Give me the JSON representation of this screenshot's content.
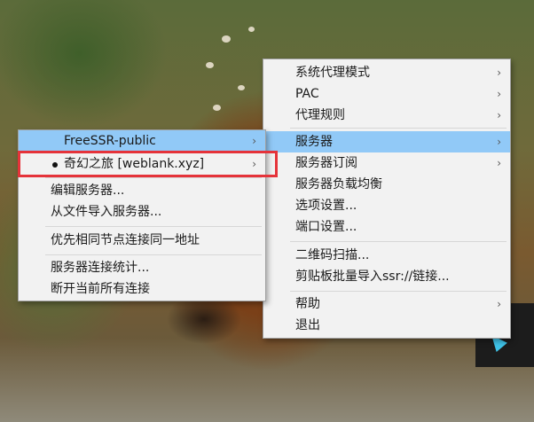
{
  "main_menu": {
    "items": [
      {
        "label": "系统代理模式",
        "has_submenu": true
      },
      {
        "label": "PAC",
        "has_submenu": true
      },
      {
        "label": "代理规则",
        "has_submenu": true
      },
      {
        "label": "服务器",
        "has_submenu": true,
        "highlighted": true
      },
      {
        "label": "服务器订阅",
        "has_submenu": true
      },
      {
        "label": "服务器负载均衡",
        "has_submenu": false
      },
      {
        "label": "选项设置...",
        "has_submenu": false
      },
      {
        "label": "端口设置...",
        "has_submenu": false
      },
      {
        "label": "二维码扫描...",
        "has_submenu": false
      },
      {
        "label": "剪贴板批量导入ssr://链接...",
        "has_submenu": false
      },
      {
        "label": "帮助",
        "has_submenu": true
      },
      {
        "label": "退出",
        "has_submenu": false
      }
    ]
  },
  "server_submenu": {
    "items": [
      {
        "label": "FreeSSR-public",
        "has_submenu": true,
        "highlighted": true
      },
      {
        "label": "奇幻之旅 [weblank.xyz]",
        "has_submenu": true,
        "selected": true
      },
      {
        "label": "编辑服务器..."
      },
      {
        "label": "从文件导入服务器..."
      },
      {
        "label": "优先相同节点连接同一地址"
      },
      {
        "label": "服务器连接统计..."
      },
      {
        "label": "断开当前所有连接"
      }
    ]
  },
  "submenu_arrow": "›",
  "colors": {
    "highlight": "#91c9f7",
    "annotation_box": "#e5333a",
    "menu_bg": "#f2f2f2"
  }
}
